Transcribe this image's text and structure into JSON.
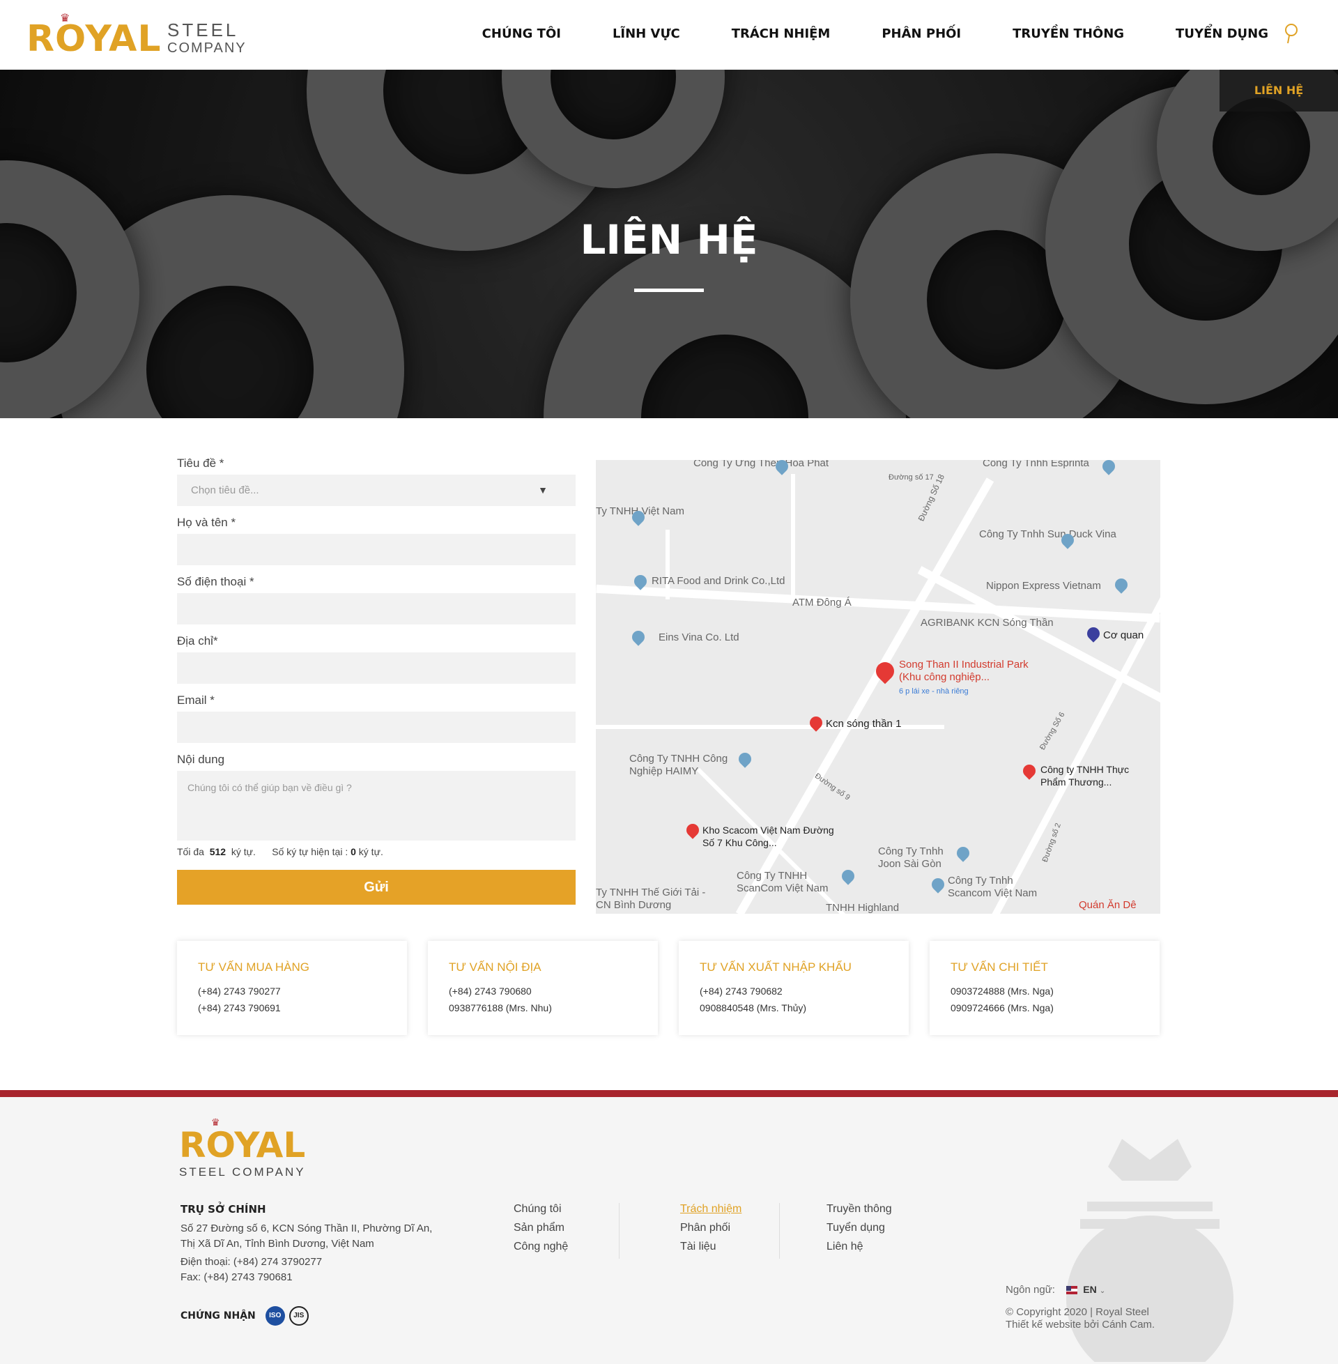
{
  "header": {
    "logo": {
      "royal": "ROYAL",
      "steel": "STEEL",
      "company": "COMPANY"
    },
    "nav": [
      "CHÚNG TÔI",
      "LĨNH VỰC",
      "TRÁCH NHIỆM",
      "PHÂN PHỐI",
      "TRUYỀN THÔNG",
      "TUYỂN DỤNG"
    ]
  },
  "hero": {
    "title": "LIÊN HỆ",
    "breadcrumb": "LIÊN HỆ"
  },
  "form": {
    "subject_label": "Tiêu đề *",
    "subject_placeholder": "Chọn tiêu đề...",
    "name_label": "Họ và tên *",
    "phone_label": "Số điện thoại *",
    "address_label": "Địa chỉ*",
    "email_label": "Email *",
    "content_label": "Nội dung",
    "content_placeholder": "Chúng tôi có thể giúp bạn về điều gì ?",
    "counter_prefix": "Tối đa",
    "counter_max": "512",
    "counter_unit": "ký tự.",
    "counter_current_prefix": "Số ký tự hiện tại :",
    "counter_current": "0",
    "counter_current_unit": "ký tự.",
    "submit": "Gửi"
  },
  "map": {
    "labels": [
      "Công Ty Ứng Thép Hòa Phát",
      "Công Ty Tnhh Esprinta",
      "Đường số 17",
      "Đường Số 18",
      "Ty TNHH Việt Nam",
      "Công Ty Tnhh Sun Duck Vina",
      "RITA Food and Drink Co.,Ltd",
      "Nippon Express Vietnam",
      "ATM Đông Á",
      "AGRIBANK KCN Sóng Thần",
      "Eins Vina Co. Ltd",
      "Cơ quan",
      "Song Than II Industrial Park (Khu công nghiệp...",
      "6 p lái xe - nhà riêng",
      "Kcn sóng thần 1",
      "Công Ty TNHH Công Nghiệp HAIMY",
      "Công ty TNHH Thực Phẩm Thương...",
      "Kho Scacom Việt Nam Đường Số 7 Khu Công...",
      "Công Ty Tnhh Joon Sài Gòn",
      "Công Ty TNHH ScanCom Việt Nam",
      "Công Ty Tnhh Scancom Việt Nam",
      "Ty TNHH Thế Giới Tải - CN Bình Dương",
      "TNHH Highland",
      "Quán Ăn Dê",
      "Đường số 9",
      "Đường Số 6",
      "Đường số 2"
    ]
  },
  "cards": [
    {
      "title": "TƯ VẤN MUA HÀNG",
      "line1": "(+84) 2743 790277",
      "line2": "(+84) 2743 790691"
    },
    {
      "title": "TƯ VẤN NỘI ĐỊA",
      "line1": "(+84) 2743 790680",
      "line2": "0938776188 (Mrs. Nhu)"
    },
    {
      "title": "TƯ VẤN XUẤT NHẬP KHẨU",
      "line1": "(+84) 2743 790682",
      "line2": "0908840548 (Mrs. Thủy)"
    },
    {
      "title": "TƯ VẤN CHI TIẾT",
      "line1": "0903724888 (Mrs. Nga)",
      "line2": "0909724666 (Mrs. Nga)"
    }
  ],
  "footer": {
    "logo_royal": "ROYAL",
    "logo_sub": "STEEL COMPANY",
    "hq_title": "TRỤ SỞ CHÍNH",
    "hq_address1": "Số 27 Đường số 6, KCN Sóng Thần II, Phường Dĩ An,",
    "hq_address2": "Thị Xã Dĩ An, Tỉnh Bình Dương, Việt Nam",
    "hq_phone": "Điện thoại: (+84) 274 3790277",
    "hq_fax": "Fax: (+84) 2743 790681",
    "cert_label": "CHỨNG NHẬN",
    "cert_iso": "ISO",
    "cert_jis": "JIS",
    "col1": [
      "Chúng tôi",
      "Sản phẩm",
      "Công nghệ"
    ],
    "col2": [
      "Trách nhiệm",
      "Phân phối",
      "Tài liệu"
    ],
    "col3": [
      "Truyền thông",
      "Tuyển dụng",
      "Liên hệ"
    ],
    "lang_label": "Ngôn ngữ:",
    "lang_value": "EN",
    "copyright": "© Copyright 2020 | Royal Steel",
    "credit": "Thiết kế website bởi Cánh Cam."
  },
  "colors": {
    "accent": "#e5a227",
    "brand_red": "#a8252d"
  }
}
